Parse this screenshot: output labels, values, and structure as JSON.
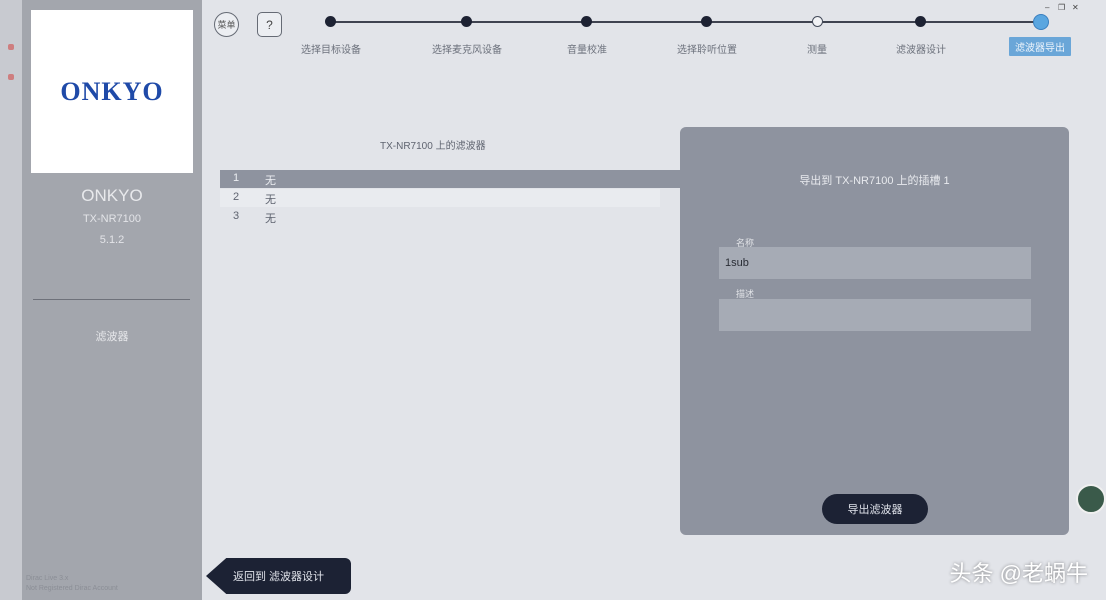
{
  "sidebar": {
    "logo": "ONKYO",
    "device_name": "ONKYO",
    "device_model": "TX-NR7100",
    "device_version": "5.1.2",
    "section_label": "滤波器",
    "footer": [
      "Dirac Live 3.x",
      "Not Registered Dirac Account"
    ]
  },
  "toolbar": {
    "menu_label": "菜单",
    "help_label": "?"
  },
  "steps": [
    {
      "label": "选择目标设备"
    },
    {
      "label": "选择麦克风设备"
    },
    {
      "label": "音量校准"
    },
    {
      "label": "选择聆听位置"
    },
    {
      "label": "测量"
    },
    {
      "label": "滤波器设计"
    },
    {
      "label": "滤波器导出"
    }
  ],
  "filters": {
    "title": "TX-NR7100 上的滤波器",
    "rows": [
      {
        "num": "1",
        "value": "无"
      },
      {
        "num": "2",
        "value": "无"
      },
      {
        "num": "3",
        "value": "无"
      }
    ]
  },
  "export_panel": {
    "title": "导出到 TX-NR7100 上的插槽 1",
    "name_label": "名称",
    "name_value": "1sub",
    "desc_label": "描述",
    "desc_value": "",
    "export_button": "导出滤波器"
  },
  "back_button": "返回到 滤波器设计",
  "watermark": "头条 @老蜗牛",
  "colors": {
    "accent_dark": "#1c2234",
    "panel": "#8e939f",
    "active_step": "#6aa6d8"
  }
}
